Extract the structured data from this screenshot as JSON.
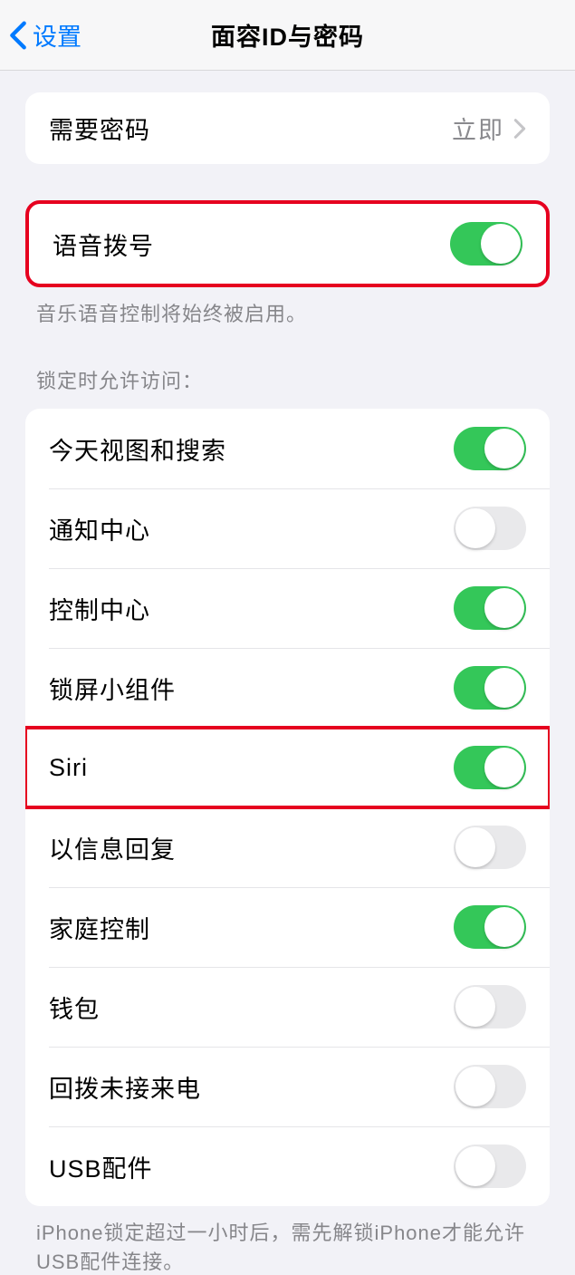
{
  "header": {
    "back_label": "设置",
    "title": "面容ID与密码"
  },
  "passcode_group": {
    "require_passcode_label": "需要密码",
    "require_passcode_value": "立即"
  },
  "voice_dial": {
    "label": "语音拨号",
    "on": true,
    "footer": "音乐语音控制将始终被启用。"
  },
  "lock_access": {
    "header": "锁定时允许访问：",
    "items": [
      {
        "label": "今天视图和搜索",
        "on": true
      },
      {
        "label": "通知中心",
        "on": false
      },
      {
        "label": "控制中心",
        "on": true
      },
      {
        "label": "锁屏小组件",
        "on": true
      },
      {
        "label": "Siri",
        "on": true,
        "highlight": true
      },
      {
        "label": "以信息回复",
        "on": false
      },
      {
        "label": "家庭控制",
        "on": true
      },
      {
        "label": "钱包",
        "on": false
      },
      {
        "label": "回拨未接来电",
        "on": false
      },
      {
        "label": "USB配件",
        "on": false
      }
    ],
    "footer": "iPhone锁定超过一小时后，需先解锁iPhone才能允许USB配件连接。"
  }
}
